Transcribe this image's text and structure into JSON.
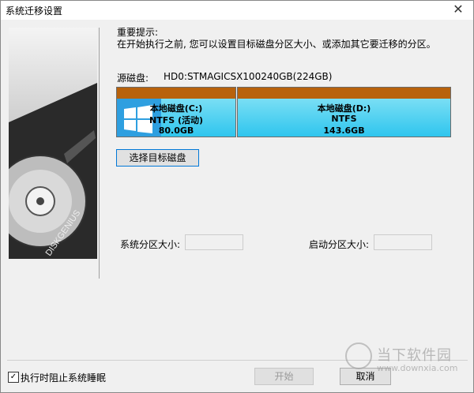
{
  "window": {
    "title": "系统迁移设置",
    "close_glyph": "✕"
  },
  "hint": {
    "heading": "重要提示:",
    "text": "在开始执行之前, 您可以设置目标磁盘分区大小、或添加其它要迁移的分区。"
  },
  "source": {
    "label": "源磁盘:",
    "value": "HD0:STMAGICSX100240GB(224GB)"
  },
  "partitions": [
    {
      "name": "本地磁盘(C:)",
      "fs": "NTFS (活动)",
      "size": "80.0GB"
    },
    {
      "name": "本地磁盘(D:)",
      "fs": "NTFS",
      "size": "143.6GB"
    }
  ],
  "buttons": {
    "select_target": "选择目标磁盘",
    "start": "开始",
    "cancel": "取消"
  },
  "fields": {
    "system_partition_label": "系统分区大小:",
    "boot_partition_label": "启动分区大小:"
  },
  "footer": {
    "prevent_sleep_label": "执行时阻止系统睡眠",
    "prevent_sleep_checked": true,
    "check_glyph": "✓"
  },
  "side_image": {
    "brand": "DISKGENIUS"
  },
  "watermark": {
    "text": "当下软件园",
    "url": "www.downxia.com"
  },
  "colors": {
    "partition_bar": "#b8620c",
    "partition_fill": "#2fc5ee",
    "selection": "#2e9fe0"
  }
}
